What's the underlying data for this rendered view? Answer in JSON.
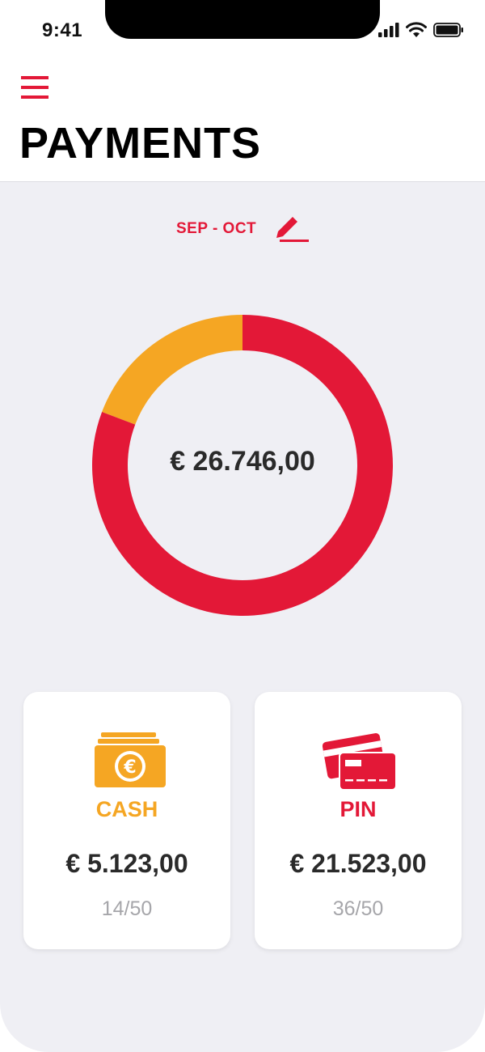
{
  "status_bar": {
    "time": "9:41"
  },
  "header": {
    "title": "PAYMENTS"
  },
  "period": {
    "label": "SEP - OCT"
  },
  "summary": {
    "total": "€ 26.746,00"
  },
  "colors": {
    "accent": "#e31837",
    "cash": "#f5a623",
    "background": "#efeff4"
  },
  "chart_data": {
    "type": "pie",
    "labels": [
      "CASH",
      "PIN"
    ],
    "values": [
      5123.0,
      21523.0
    ],
    "colors": [
      "#f5a623",
      "#e31837"
    ],
    "style": "donut"
  },
  "cards": [
    {
      "label": "CASH",
      "amount": "€ 5.123,00",
      "count": "14/50",
      "color": "#f5a623",
      "icon": "cash-icon"
    },
    {
      "label": "PIN",
      "amount": "€ 21.523,00",
      "count": "36/50",
      "color": "#e31837",
      "icon": "card-icon"
    }
  ]
}
